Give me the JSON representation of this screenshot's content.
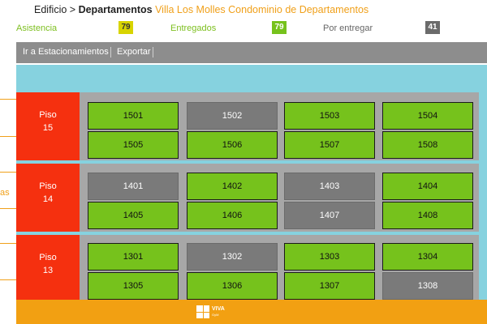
{
  "breadcrumb": {
    "root": "Edificio",
    "separator": ">",
    "section": "Departamentos",
    "project": "Villa Los Molles Condominio de Departamentos"
  },
  "stats": {
    "asistencia": {
      "label": "Asistencia",
      "value": "79"
    },
    "entregados": {
      "label": "Entregados",
      "value": "79"
    },
    "por_entregar": {
      "label": "Por entregar",
      "value": "41"
    }
  },
  "toolbar": {
    "estacionamientos": "Ir a Estacionamientos",
    "exportar": "Exportar"
  },
  "left_nav_fragment": "as",
  "floors": [
    {
      "label": "Piso",
      "number": "15",
      "units": [
        {
          "id": "1501",
          "status": "entregado"
        },
        {
          "id": "1502",
          "status": "por_entregar"
        },
        {
          "id": "1503",
          "status": "entregado"
        },
        {
          "id": "1504",
          "status": "entregado"
        },
        {
          "id": "1505",
          "status": "entregado"
        },
        {
          "id": "1506",
          "status": "entregado"
        },
        {
          "id": "1507",
          "status": "entregado"
        },
        {
          "id": "1508",
          "status": "entregado"
        }
      ]
    },
    {
      "label": "Piso",
      "number": "14",
      "units": [
        {
          "id": "1401",
          "status": "por_entregar"
        },
        {
          "id": "1402",
          "status": "entregado"
        },
        {
          "id": "1403",
          "status": "por_entregar"
        },
        {
          "id": "1404",
          "status": "entregado"
        },
        {
          "id": "1405",
          "status": "entregado"
        },
        {
          "id": "1406",
          "status": "entregado"
        },
        {
          "id": "1407",
          "status": "por_entregar"
        },
        {
          "id": "1408",
          "status": "entregado"
        }
      ]
    },
    {
      "label": "Piso",
      "number": "13",
      "units": [
        {
          "id": "1301",
          "status": "entregado"
        },
        {
          "id": "1302",
          "status": "por_entregar"
        },
        {
          "id": "1303",
          "status": "entregado"
        },
        {
          "id": "1304",
          "status": "entregado"
        },
        {
          "id": "1305",
          "status": "entregado"
        },
        {
          "id": "1306",
          "status": "entregado"
        },
        {
          "id": "1307",
          "status": "entregado"
        },
        {
          "id": "1308",
          "status": "por_entregar"
        }
      ]
    }
  ],
  "footer": {
    "logo_text": "VIVA",
    "logo_subtext": "GyM"
  },
  "colors": {
    "accent": "#f0a01a",
    "entregado": "#76c21c",
    "por_entregar": "#7a7a7a",
    "floor_label": "#f5300f",
    "sky": "#86d2df"
  }
}
